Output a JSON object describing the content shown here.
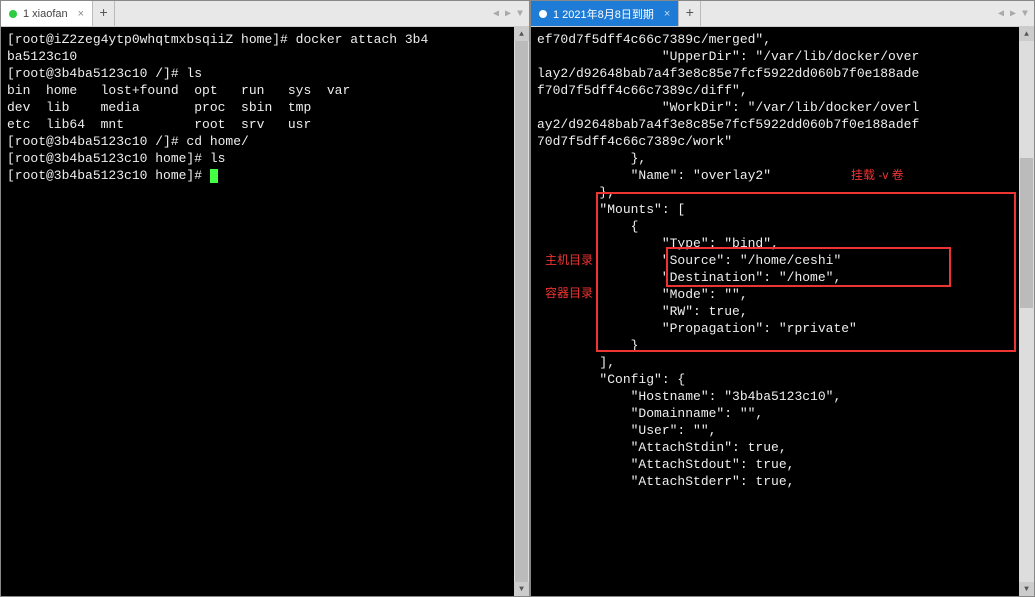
{
  "leftPane": {
    "tab": {
      "dotColor": "green",
      "label": "1 xiaofan",
      "closable": true
    },
    "addTab": "+",
    "navArrows": "◀  ▶  ▼",
    "lines": [
      "[root@iZ2zeg4ytp0whqtmxbsqiiZ home]# docker attach 3b4",
      "ba5123c10",
      "[root@3b4ba5123c10 /]# ls",
      "bin  home   lost+found  opt   run   sys  var",
      "dev  lib    media       proc  sbin  tmp",
      "etc  lib64  mnt         root  srv   usr",
      "[root@3b4ba5123c10 /]# cd home/",
      "[root@3b4ba5123c10 home]# ls",
      "[root@3b4ba5123c10 home]# "
    ]
  },
  "rightPane": {
    "tab": {
      "dotColor": "blue",
      "label": "1 2021年8月8日到期",
      "closable": true
    },
    "addTab": "+",
    "navArrows": "◀  ▶  ▼",
    "lines": [
      "ef70d7f5dff4c66c7389c/merged\",",
      "                \"UpperDir\": \"/var/lib/docker/over",
      "lay2/d92648bab7a4f3e8c85e7fcf5922dd060b7f0e188ade",
      "f70d7f5dff4c66c7389c/diff\",",
      "                \"WorkDir\": \"/var/lib/docker/overl",
      "ay2/d92648bab7a4f3e8c85e7fcf5922dd060b7f0e188adef",
      "70d7f5dff4c66c7389c/work\"",
      "            },",
      "            \"Name\": \"overlay2\"",
      "        },",
      "        \"Mounts\": [",
      "            {",
      "                \"Type\": \"bind\",",
      "                \"Source\": \"/home/ceshi\"",
      "                \"Destination\": \"/home\",",
      "                \"Mode\": \"\",",
      "                \"RW\": true,",
      "                \"Propagation\": \"rprivate\"",
      "            }",
      "        ],",
      "        \"Config\": {",
      "            \"Hostname\": \"3b4ba5123c10\",",
      "            \"Domainname\": \"\",",
      "            \"User\": \"\",",
      "            \"AttachStdin\": true,",
      "            \"AttachStdout\": true,",
      "            \"AttachStderr\": true,"
    ],
    "annotations": {
      "mountLabel": "挂载 -v 卷",
      "hostDirLabel": "主机目录",
      "containerDirLabel": "容器目录"
    }
  }
}
